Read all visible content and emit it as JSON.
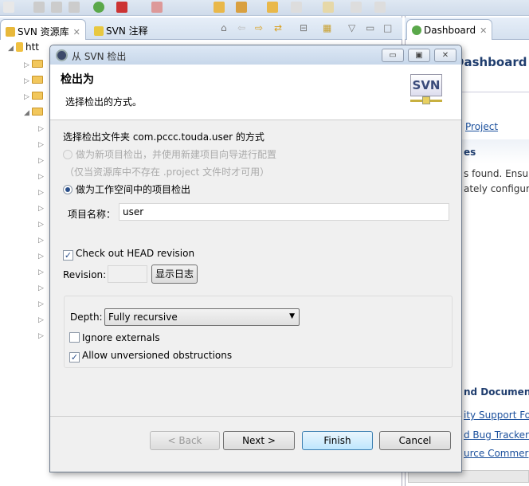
{
  "left_tabs": [
    {
      "label": "SVN 资源库",
      "active": true
    },
    {
      "label": "SVN 注释",
      "active": false
    }
  ],
  "tree": {
    "root_label": "htt"
  },
  "right_tabs": [
    {
      "label": "Dashboard",
      "active": true
    }
  ],
  "right_panel": {
    "title": "Dashboard",
    "project_link": "Project",
    "section1": "es",
    "line1": "s found. Ensu",
    "line2": "ately configure",
    "section2": "nd Document",
    "links": [
      "ity Support Fo",
      "d Bug Tracker",
      "urce Commer"
    ]
  },
  "dialog": {
    "title": "从 SVN 检出",
    "header_title": "检出为",
    "header_desc": "选择检出的方式。",
    "logo_text": "SVN",
    "prompt": "选择检出文件夹 com.pccc.touda.user 的方式",
    "option_new_project": {
      "label": "做为新项目检出，并使用新建项目向导进行配置",
      "selected": false,
      "enabled": false
    },
    "option_note": "（仅当资源库中不存在 .project 文件时才可用）",
    "option_workspace": {
      "label": "做为工作空间中的项目检出",
      "selected": true
    },
    "project_name_label": "项目名称：",
    "project_name_value": "user",
    "checkout_head": {
      "label": "Check out HEAD revision",
      "checked": true
    },
    "revision_label": "Revision:",
    "revision_value": "",
    "show_log": "显示日志",
    "depth_label": "Depth:",
    "depth_value": "Fully recursive",
    "ignore_externals": {
      "label": "Ignore externals",
      "checked": false
    },
    "allow_unversioned": {
      "label": "Allow unversioned obstructions",
      "checked": true
    },
    "buttons": {
      "back": "< Back",
      "next": "Next >",
      "finish": "Finish",
      "cancel": "Cancel"
    }
  }
}
